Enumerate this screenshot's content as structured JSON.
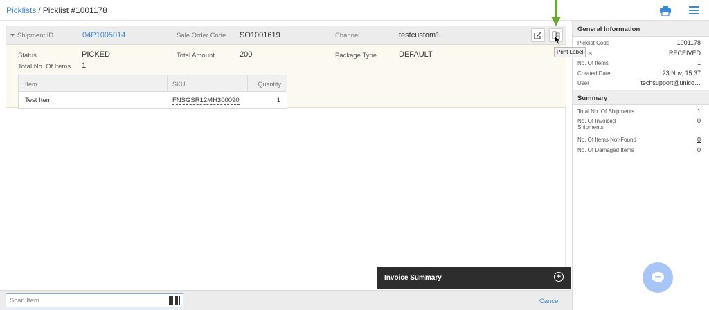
{
  "breadcrumb": {
    "root": "Picklists",
    "current": "Picklist #1001178"
  },
  "shipment": {
    "id_label": "Shipment ID",
    "id_value": "04P1005014",
    "sale_order_label": "Sale Order Code",
    "sale_order_value": "SO1001619",
    "channel_label": "Channel",
    "channel_value": "testcustom1",
    "status_label": "Status",
    "status_value": "PICKED",
    "total_amount_label": "Total Amount",
    "total_amount_value": "200",
    "package_type_label": "Package Type",
    "package_type_value": "DEFAULT",
    "total_items_label": "Total No. Of Items",
    "total_items_value": "1",
    "table": {
      "headers": [
        "Item",
        "SKU",
        "Quantity"
      ],
      "rows": [
        {
          "item": "Test Item",
          "sku": "FNSGSR12MH300090",
          "quantity": "1"
        }
      ]
    }
  },
  "tooltip": "Print Label",
  "invoice_summary": "Invoice Summary",
  "scan": {
    "placeholder": "Scan Item"
  },
  "cancel_label": "Cancel",
  "general_info": {
    "title": "General Information",
    "rows": [
      {
        "k": "Picklist Code",
        "v": "1001178"
      },
      {
        "k": "s",
        "v": "RECEIVED"
      },
      {
        "k": "No. Of Items",
        "v": "1"
      },
      {
        "k": "Created Date",
        "v": "23 Nov, 15:37"
      },
      {
        "k": "User",
        "v": "techsupport@unico…"
      }
    ]
  },
  "summary": {
    "title": "Summary",
    "rows": [
      {
        "k": "Total No. Of Shipments",
        "v": "1"
      },
      {
        "k": "No. Of Invoiced Shipments",
        "v": "0"
      },
      {
        "k": "No. Of Items Not-Found",
        "v": "0"
      },
      {
        "k": "No. Of Damaged Items",
        "v": "0"
      }
    ]
  },
  "colors": {
    "link": "#3d8bd8",
    "accent_arrow": "#6aa83a",
    "chat": "#a8c6f5"
  },
  "icons": [
    "print-icon",
    "menu-icon",
    "edit-icon",
    "print-label-icon",
    "barcode-icon",
    "plus-circle-icon",
    "chat-icon",
    "caret-down-icon"
  ]
}
